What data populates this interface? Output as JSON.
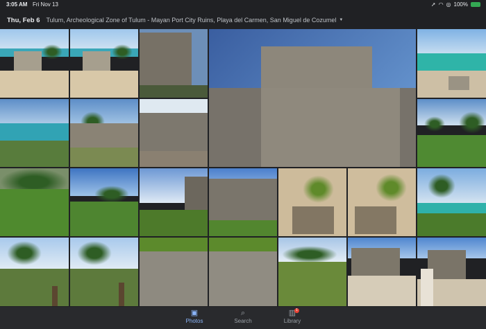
{
  "status_bar": {
    "time": "3:05 AM",
    "date": "Fri Nov 13",
    "battery": "100%",
    "wifi_icon": "wifi-icon",
    "battery_icon": "battery-charging-icon"
  },
  "header": {
    "date_label": "Thu, Feb 6",
    "location": "Tulum, Archeological Zone of Tulum - Mayan Port City Ruins, Playa del Carmen, San Miguel de Cozumel",
    "caret_icon": "dropdown-caret-icon"
  },
  "photos": [
    "beach-palms-1",
    "beach-palms-2",
    "ruin-tower-closeup",
    "el-castillo-large",
    "beach-turquoise-sea",
    "coast-cliff-sea",
    "ruin-stairs-palm",
    "ruin-wall-platforms",
    "lawn-ruins-right",
    "lawn-palm-trees",
    "lawn-palms-ruins",
    "ruin-structure-lawn",
    "ruin-small-shadow",
    "sand-plant-shadow-1",
    "sand-plant-shadow-2",
    "palm-sea-rocks",
    "palms-beach-fence",
    "palms-beach-fence-2",
    "stone-wall-iguana-1",
    "stone-wall-iguana-2",
    "palms-grass-field",
    "ruin-path-gate",
    "tourist-ruin-temple"
  ],
  "tabs": [
    {
      "label": "Photos",
      "icon": "photos-icon"
    },
    {
      "label": "Search",
      "icon": "search-icon"
    },
    {
      "label": "Library",
      "icon": "library-icon",
      "badge": "1"
    }
  ]
}
